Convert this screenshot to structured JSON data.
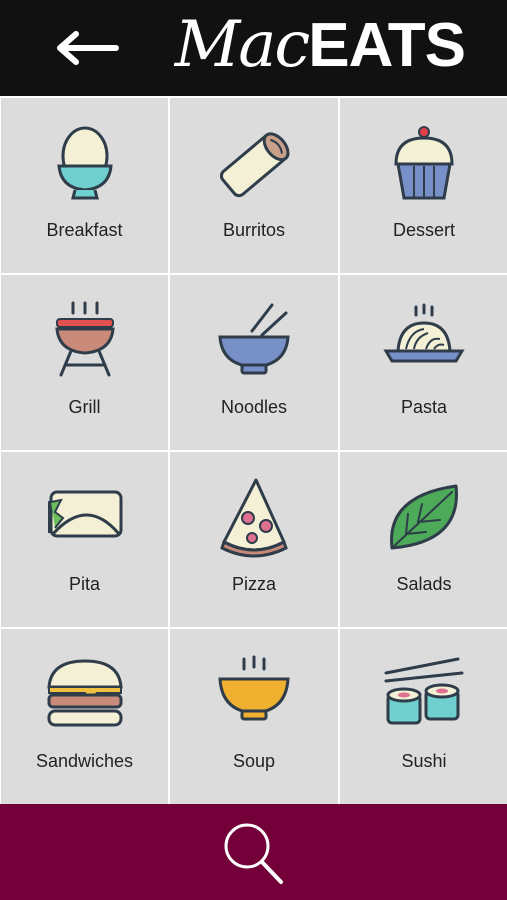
{
  "header": {
    "back_icon": "arrow-left-icon",
    "logo_mac": "Mac",
    "logo_eats": "EATS"
  },
  "categories": [
    {
      "label": "Breakfast",
      "icon": "egg-cup-icon"
    },
    {
      "label": "Burritos",
      "icon": "burrito-icon"
    },
    {
      "label": "Dessert",
      "icon": "cupcake-icon"
    },
    {
      "label": "Grill",
      "icon": "grill-icon"
    },
    {
      "label": "Noodles",
      "icon": "noodle-bowl-icon"
    },
    {
      "label": "Pasta",
      "icon": "pasta-plate-icon"
    },
    {
      "label": "Pita",
      "icon": "pita-wrap-icon"
    },
    {
      "label": "Pizza",
      "icon": "pizza-slice-icon"
    },
    {
      "label": "Salads",
      "icon": "leaf-icon"
    },
    {
      "label": "Sandwiches",
      "icon": "burger-icon"
    },
    {
      "label": "Soup",
      "icon": "soup-bowl-icon"
    },
    {
      "label": "Sushi",
      "icon": "sushi-icon"
    }
  ],
  "footer": {
    "search_icon": "search-icon"
  },
  "colors": {
    "header_bg": "#111111",
    "tile_bg": "#dcdcdc",
    "footer_bg": "#74003a",
    "icon_stroke": "#2f3d4a"
  }
}
